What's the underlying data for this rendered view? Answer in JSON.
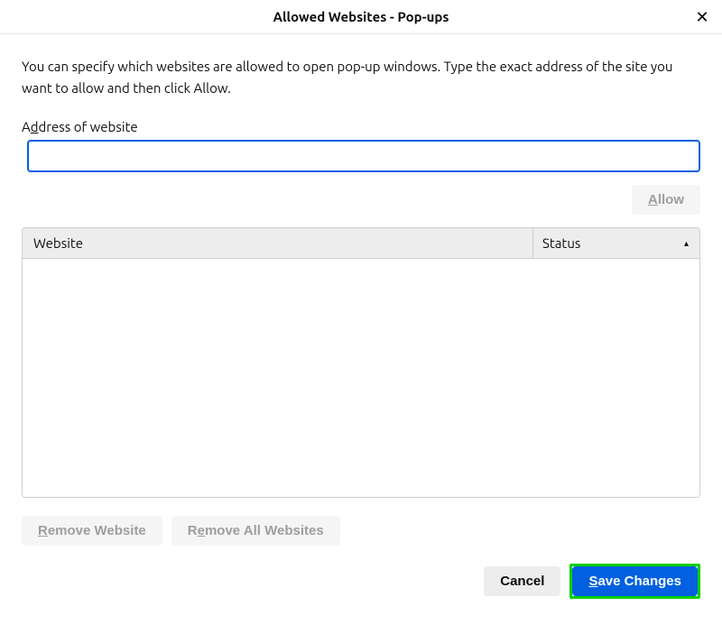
{
  "dialog": {
    "title": "Allowed Websites - Pop-ups",
    "close_icon": "✕"
  },
  "description": "You can specify which websites are allowed to open pop-up windows. Type the exact address of the site you want to allow and then click Allow.",
  "address": {
    "label_prefix": "A",
    "label_accesskey": "d",
    "label_suffix": "dress of website",
    "value": ""
  },
  "buttons": {
    "allow_accesskey": "A",
    "allow_suffix": "llow",
    "remove_website_accesskey": "R",
    "remove_website_suffix": "emove Website",
    "remove_all_prefix": "R",
    "remove_all_accesskey": "e",
    "remove_all_suffix": "move All Websites",
    "cancel": "Cancel",
    "save_accesskey": "S",
    "save_suffix": "ave Changes"
  },
  "table": {
    "col_website": "Website",
    "col_status": "Status",
    "sort_arrow": "▴",
    "rows": []
  }
}
